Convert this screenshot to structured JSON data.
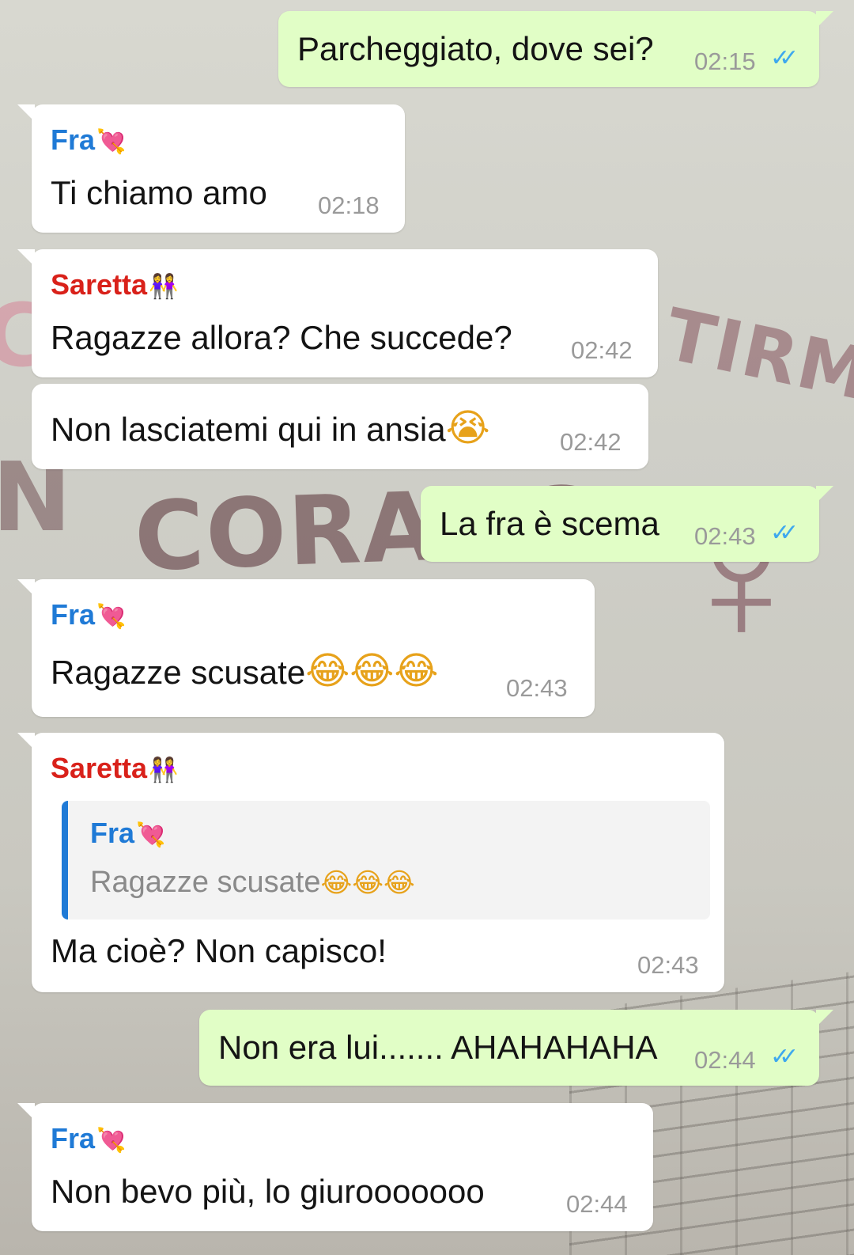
{
  "messages": [
    {
      "text": "Parcheggiato, dove sei?",
      "time": "02:15",
      "ticks": "✓✓"
    },
    {
      "sender": "Fra",
      "sender_emoji": "💘",
      "text": "Ti chiamo amo",
      "time": "02:18"
    },
    {
      "sender": "Saretta",
      "sender_emoji": "👭",
      "text": "Ragazze allora? Che succede?",
      "time": "02:42"
    },
    {
      "text": "Non lasciatemi qui in ansia",
      "emoji": "😭",
      "time": "02:42"
    },
    {
      "text": "La fra è scema",
      "time": "02:43",
      "ticks": "✓✓"
    },
    {
      "sender": "Fra",
      "sender_emoji": "💘",
      "text": "Ragazze scusate",
      "emoji": "😂😂😂",
      "time": "02:43"
    },
    {
      "sender": "Saretta",
      "sender_emoji": "👭",
      "quote_sender": "Fra",
      "quote_sender_emoji": "💘",
      "quote_text": "Ragazze scusate",
      "quote_emoji": "😂😂😂",
      "text": "Ma cioè? Non capisco!",
      "time": "02:43"
    },
    {
      "text": "Non era lui....... AHAHAHAHA",
      "time": "02:44",
      "ticks": "✓✓"
    },
    {
      "sender": "Fra",
      "sender_emoji": "💘",
      "text": "Non bevo più, lo giurooooooo",
      "time": "02:44"
    }
  ],
  "colors": {
    "incoming_bubble": "#ffffff",
    "outgoing_bubble": "#e1fec6",
    "sender_fra": "#1f7ad6",
    "sender_saretta": "#d9211a",
    "read_ticks": "#3ea8ee",
    "timestamp": "#9a9a9a"
  },
  "icons": {
    "read_receipt": "double-check-icon"
  }
}
